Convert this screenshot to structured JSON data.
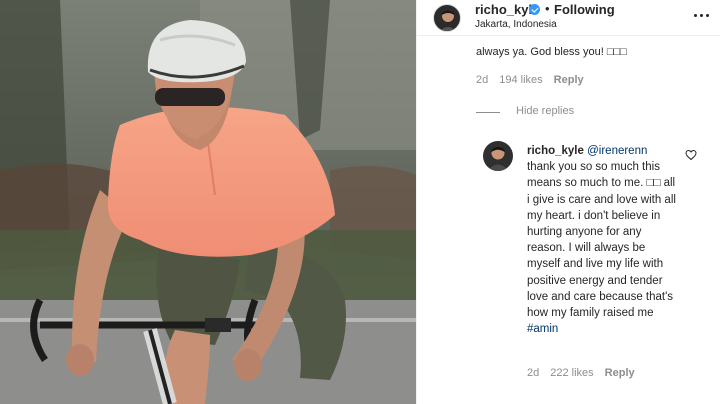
{
  "post": {
    "username": "richo_kyle",
    "dot": "•",
    "following_label": "Following",
    "location": "Jakarta, Indonesia",
    "more_icon": "more-horizontal-icon",
    "verified_icon": "verified-badge-icon"
  },
  "parent_comment": {
    "text_fragment": "always ya. God bless you! □□□",
    "age": "2d",
    "likes": "194 likes",
    "reply_label": "Reply"
  },
  "hide_replies_label": "Hide replies",
  "reply": {
    "username": "richo_kyle",
    "mention": "@irenerenn",
    "text": "thank you so so much this means so much to me. □□ all i give is care and love with all my heart. i don't believe in hurting anyone for any reason. I will always be myself and live my life with positive energy and tender love and care because that's how my family raised me",
    "hashtag": "#amin",
    "age": "2d",
    "likes": "222 likes",
    "reply_label": "Reply",
    "like_icon": "heart-outline-icon"
  },
  "colors": {
    "link": "#003569",
    "muted": "#8e8e8e",
    "text": "#262626",
    "verified": "#3897f0",
    "jersey": "#f49a7a"
  }
}
